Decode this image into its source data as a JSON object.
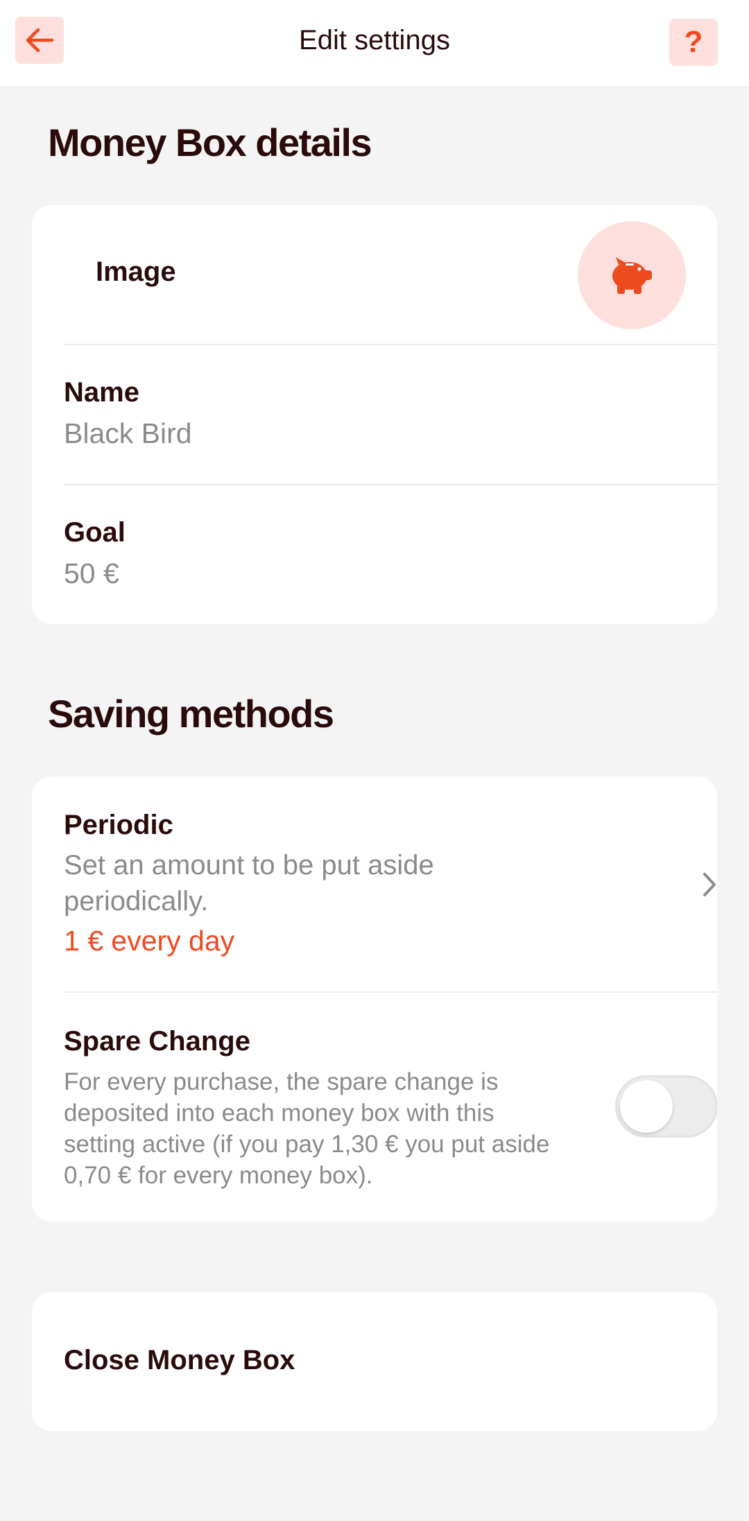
{
  "header": {
    "title": "Edit settings",
    "back_icon": "arrow-left-icon",
    "help_label": "?"
  },
  "details": {
    "title": "Money Box details",
    "image_label": "Image",
    "image_icon": "piggy-bank-icon",
    "name_label": "Name",
    "name_value": "Black Bird",
    "goal_label": "Goal",
    "goal_value": "50 €"
  },
  "saving": {
    "title": "Saving methods",
    "periodic": {
      "label": "Periodic",
      "description": "Set an amount to be put aside periodically.",
      "value": "1 € every day"
    },
    "spare_change": {
      "label": "Spare Change",
      "description": "For every purchase, the spare change is deposited into each money box with this setting active (if you pay 1,30 € you put aside 0,70 € for every money box).",
      "enabled": false
    }
  },
  "close": {
    "label": "Close Money Box"
  },
  "colors": {
    "accent": "#ee4a1f",
    "accent_soft": "#fde0de",
    "text_dark": "#2a0a0a",
    "text_muted": "#8a8a8a",
    "background": "#f4f4f4"
  }
}
